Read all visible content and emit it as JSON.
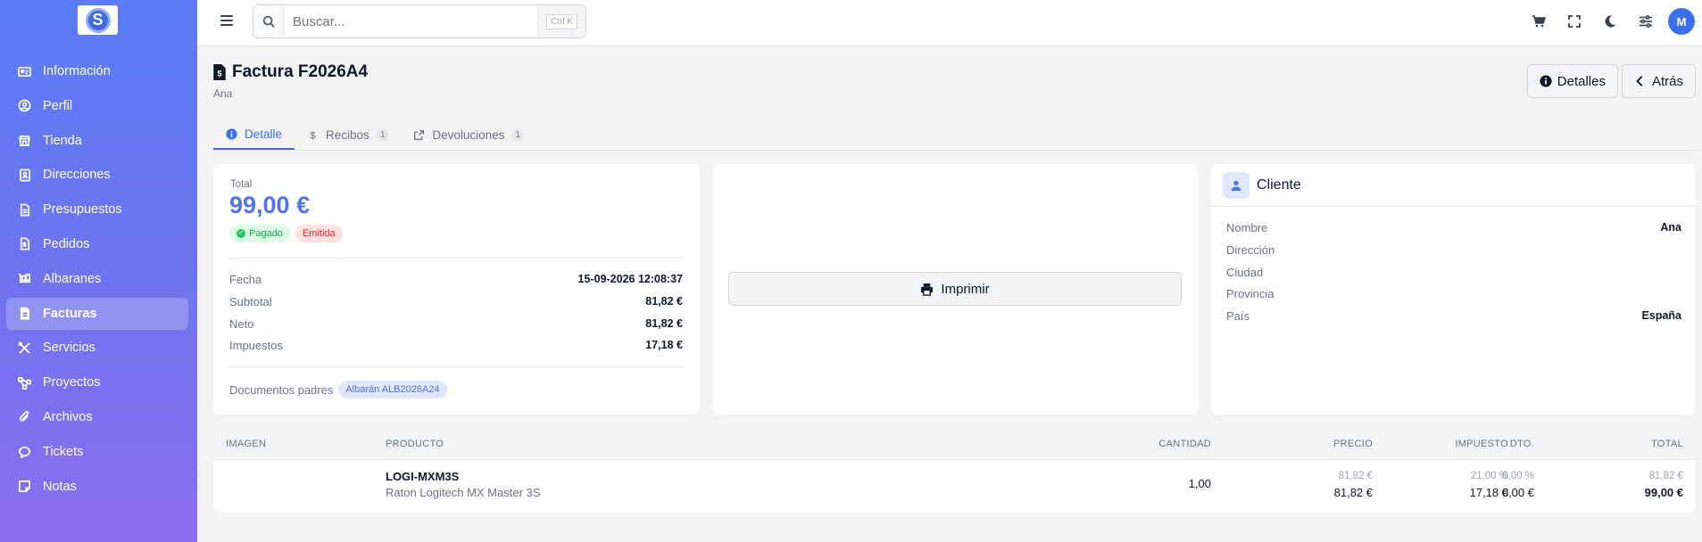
{
  "sidebar": {
    "logo": "S",
    "items": [
      {
        "label": "Información",
        "icon": "id-card-icon"
      },
      {
        "label": "Perfil",
        "icon": "user-circle-icon"
      },
      {
        "label": "Tienda",
        "icon": "store-icon"
      },
      {
        "label": "Direcciones",
        "icon": "address-book-icon"
      },
      {
        "label": "Presupuestos",
        "icon": "file-icon"
      },
      {
        "label": "Pedidos",
        "icon": "file-dollar-icon"
      },
      {
        "label": "Albaranes",
        "icon": "dolly-icon"
      },
      {
        "label": "Facturas",
        "icon": "file-invoice-icon",
        "active": true
      },
      {
        "label": "Servicios",
        "icon": "tools-icon"
      },
      {
        "label": "Proyectos",
        "icon": "diagram-icon"
      },
      {
        "label": "Archivos",
        "icon": "paperclip-icon"
      },
      {
        "label": "Tickets",
        "icon": "chat-icon"
      },
      {
        "label": "Notas",
        "icon": "note-icon"
      }
    ]
  },
  "topbar": {
    "search_placeholder": "Buscar...",
    "shortcut": "Ctrl K",
    "avatar": "M"
  },
  "header": {
    "title": "Factura F2026A4",
    "subtitle": "Ana",
    "details_button": "Detalles",
    "back_button": "Atrás"
  },
  "tabs": [
    {
      "label": "Detalle",
      "count": ""
    },
    {
      "label": "Recibos",
      "count": "1"
    },
    {
      "label": "Devoluciones",
      "count": "1"
    }
  ],
  "summary": {
    "total_label": "Total",
    "total_value": "99,00 €",
    "badge_paid": "Pagado",
    "badge_issued": "Emitida",
    "rows": [
      {
        "k": "Fecha",
        "v": "15-09-2026 12:08:37"
      },
      {
        "k": "Subtotal",
        "v": "81,82 €"
      },
      {
        "k": "Neto",
        "v": "81,82 €"
      },
      {
        "k": "Impuestos",
        "v": "17,18 €"
      }
    ],
    "parents_label": "Documentos padres",
    "parent_doc": "Albarán ALB2026A24"
  },
  "print": {
    "label": "Imprimir"
  },
  "client": {
    "title": "Cliente",
    "rows": [
      {
        "k": "Nombre",
        "v": "Ana"
      },
      {
        "k": "Dirección",
        "v": ""
      },
      {
        "k": "Ciudad",
        "v": ""
      },
      {
        "k": "Provincia",
        "v": ""
      },
      {
        "k": "País",
        "v": "España"
      }
    ]
  },
  "table": {
    "headers": {
      "image": "IMAGEN",
      "product": "PRODUCTO",
      "qty": "CANTIDAD",
      "price": "PRECIO",
      "discount": "DTO.",
      "tax": "IMPUESTO",
      "total": "TOTAL"
    },
    "rows": [
      {
        "sku": "LOGI-MXM3S",
        "name": "Raton Logitech MX Master 3S",
        "qty": "1,00",
        "price_small": "81,82 €",
        "price": "81,82 €",
        "discount_small": "0,00 %",
        "discount": "0,00 €",
        "tax_small": "21,00 %",
        "tax": "17,18 €",
        "total_small": "81,82 €",
        "total": "99,00 €"
      }
    ]
  },
  "colors": {
    "accent": "#3b6ff0",
    "sidebar_top": "#5b7cf6",
    "sidebar_bottom": "#8b6ef0"
  }
}
